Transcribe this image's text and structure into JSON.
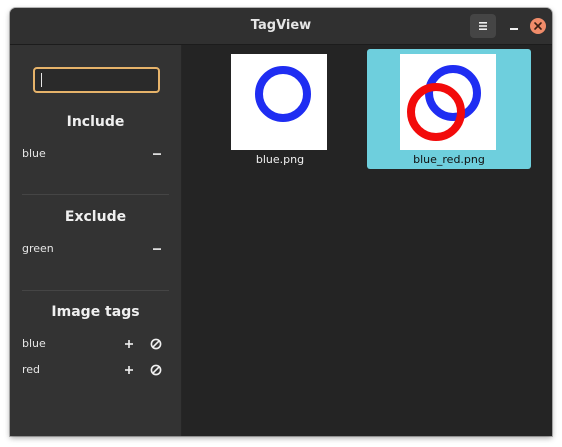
{
  "window": {
    "title": "TagView",
    "menu_icon": "menu-icon",
    "minimize_icon": "minimize-icon",
    "close_icon": "close-icon",
    "close_color": "#f08c6a"
  },
  "sidebar": {
    "search": {
      "value": "",
      "placeholder": ""
    },
    "include": {
      "title": "Include",
      "items": [
        {
          "label": "blue",
          "action_icon": "remove-icon"
        }
      ]
    },
    "exclude": {
      "title": "Exclude",
      "items": [
        {
          "label": "green",
          "action_icon": "remove-icon"
        }
      ]
    },
    "image_tags": {
      "title": "Image tags",
      "items": [
        {
          "label": "blue",
          "actions": [
            "add-icon",
            "exclude-icon"
          ]
        },
        {
          "label": "red",
          "actions": [
            "add-icon",
            "exclude-icon"
          ]
        }
      ]
    }
  },
  "gallery": {
    "items": [
      {
        "filename": "blue.png",
        "selected": false
      },
      {
        "filename": "blue_red.png",
        "selected": true
      }
    ],
    "selection_color": "#6ecfdd"
  }
}
